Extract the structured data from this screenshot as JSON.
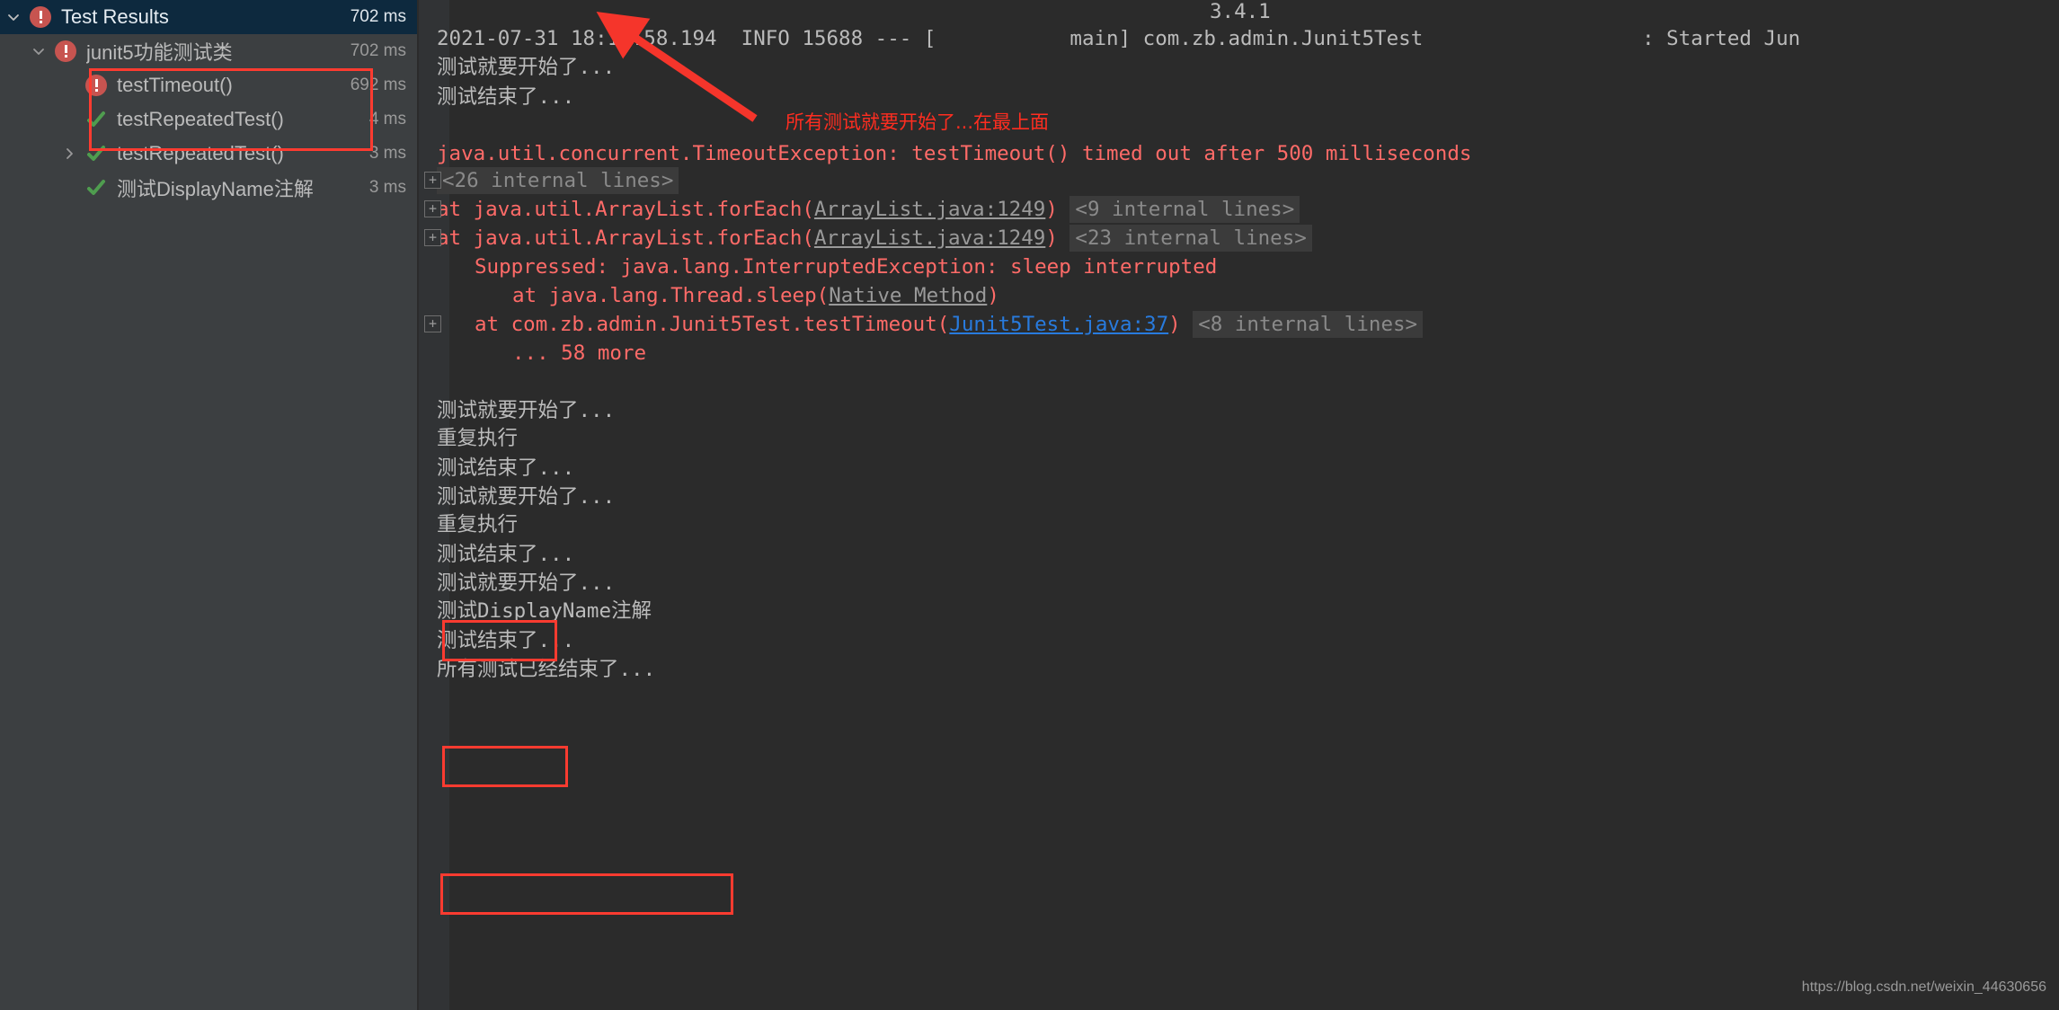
{
  "tree": {
    "rows": [
      {
        "label": "Test Results",
        "time": "702 ms",
        "icon": "error-icon",
        "twisty": "chevron-down-icon",
        "indent": 0,
        "selected": true
      },
      {
        "label": "junit5功能测试类",
        "time": "702 ms",
        "icon": "error-icon",
        "twisty": "chevron-down-icon",
        "indent": 1,
        "selected": false
      },
      {
        "label": "testTimeout()",
        "time": "692 ms",
        "icon": "error-icon",
        "twisty": "",
        "indent": 2,
        "selected": false
      },
      {
        "label": "testRepeatedTest()",
        "time": "4 ms",
        "icon": "check-icon",
        "twisty": "",
        "indent": 2,
        "selected": false
      },
      {
        "label": "testRepeatedTest()",
        "time": "3 ms",
        "icon": "check-icon",
        "twisty": "chevron-right-icon",
        "indent": 2,
        "selected": false
      },
      {
        "label": "测试DisplayName注解",
        "time": "3 ms",
        "icon": "check-icon",
        "twisty": "",
        "indent": 2,
        "selected": false
      }
    ]
  },
  "console": {
    "version_line": "3.4.1",
    "log_line_top": "2021-07-31 18:17:58.194  INFO 15688 --- [           main] com.zb.admin.Junit5Test                  : Started Jun",
    "line_start_1": "测试就要开始了...",
    "line_end_1": "测试结束了...",
    "exception_header": "java.util.concurrent.TimeoutException: testTimeout() timed out after 500 milliseconds",
    "internal_26": "<26 internal lines>",
    "foreach_1_text": "at java.util.ArrayList.forEach(",
    "foreach_1_link": "ArrayList.java:1249",
    "foreach_1_tail": ")",
    "internal_9": "<9 internal lines>",
    "foreach_2_text": "at java.util.ArrayList.forEach(",
    "foreach_2_link": "ArrayList.java:1249",
    "foreach_2_tail": ")",
    "internal_23": "<23 internal lines>",
    "suppressed": "Suppressed: java.lang.InterruptedException: sleep interrupted",
    "thread_sleep_text": "at java.lang.Thread.sleep(",
    "thread_sleep_link": "Native Method",
    "thread_sleep_tail": ")",
    "junit_frame_text": "at com.zb.admin.Junit5Test.testTimeout(",
    "junit_frame_link": "Junit5Test.java:37",
    "junit_frame_tail": ")",
    "internal_8": "<8 internal lines>",
    "more_58": "... 58 more",
    "block_a_start": "测试就要开始了...",
    "block_a_body": "重复执行",
    "block_a_end": "测试结束了...",
    "block_b_start": "测试就要开始了...",
    "block_b_body": "重复执行",
    "block_b_end": "测试结束了...",
    "block_c_start": "测试就要开始了...",
    "block_c_body": "测试DisplayName注解",
    "block_c_end": "测试结束了...",
    "all_done": "所有测试已经结束了...",
    "plus_glyph": "+"
  },
  "annotation": {
    "note": "所有测试就要开始了...在最上面",
    "color": "#ff2d20"
  },
  "watermark": "https://blog.csdn.net/weixin_44630656"
}
